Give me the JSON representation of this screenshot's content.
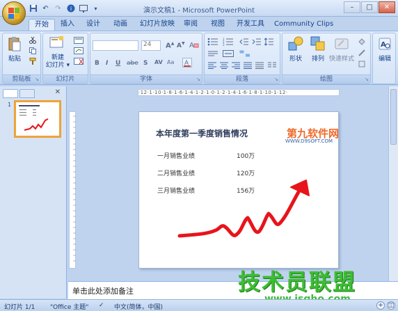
{
  "window": {
    "title": "演示文稿1 - Microsoft PowerPoint"
  },
  "tabs": [
    {
      "label": "开始",
      "active": true
    },
    {
      "label": "插入"
    },
    {
      "label": "设计"
    },
    {
      "label": "动画"
    },
    {
      "label": "幻灯片放映"
    },
    {
      "label": "审阅"
    },
    {
      "label": "视图"
    },
    {
      "label": "开发工具"
    },
    {
      "label": "Community Clips"
    }
  ],
  "ribbon": {
    "groups": {
      "clipboard": "剪贴板",
      "slides": "幻灯片",
      "font": "字体",
      "paragraph": "段落",
      "drawing": "绘图",
      "editing": "编辑"
    },
    "buttons": {
      "paste": "粘贴",
      "new_slide": "新建\n幻灯片 ▾",
      "shapes": "形状",
      "arrange": "排列",
      "quick_styles": "快速样式",
      "editing": "编辑"
    },
    "font_size": "24"
  },
  "slide_panel": {
    "slide_number": "1"
  },
  "slide": {
    "title": "本年度第一季度销售情况",
    "rows": [
      {
        "label": "一月销售业绩",
        "value": "100万"
      },
      {
        "label": "二月销售业绩",
        "value": "120万"
      },
      {
        "label": "三月销售业绩",
        "value": "156万"
      }
    ]
  },
  "watermarks": {
    "top": "第九软件网",
    "top_sub": "WWW.D9SOFT.COM",
    "bottom": "技术员联盟",
    "bottom_sub": "www.jsgho.com"
  },
  "ruler": "·12·1·10·1·8·1·6·1·4·1·2·1·0·1·2·1·4·1·6·1·8·1·10·1·12·",
  "notes": {
    "placeholder": "单击此处添加备注"
  },
  "status": {
    "slide_info": "幻灯片 1/1",
    "theme": "\"Office 主题\"",
    "language": "中文(简体，中国)"
  },
  "colors": {
    "accent_orange": "#f2a33a",
    "arrow_red": "#e8141b",
    "ribbon_blue": "#d2e2f6"
  }
}
